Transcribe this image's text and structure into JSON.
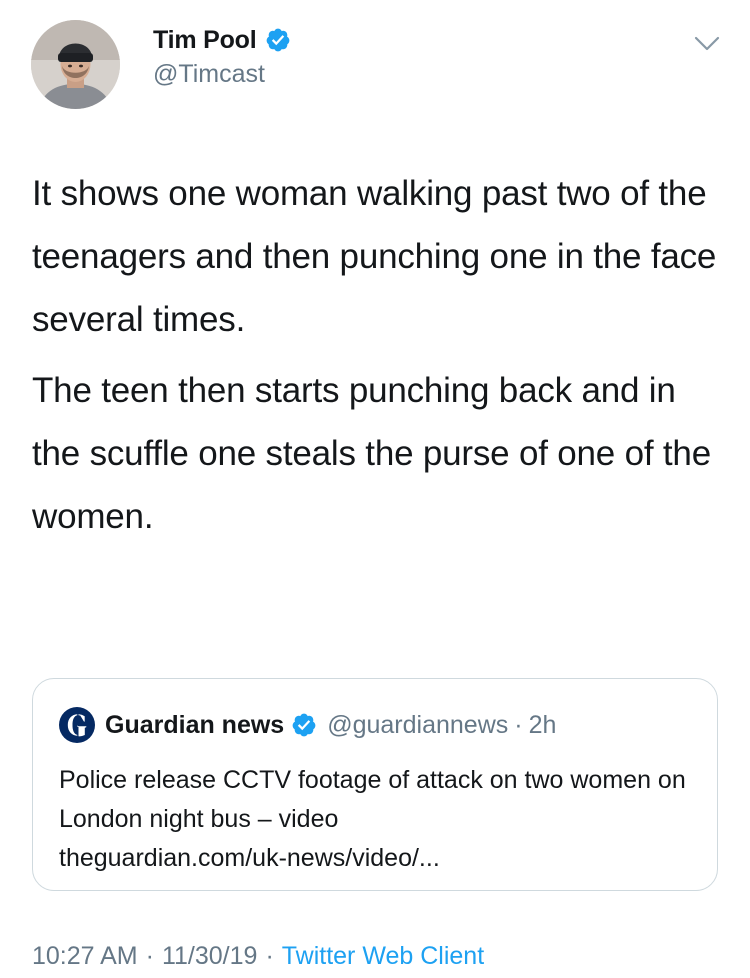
{
  "author": {
    "name": "Tim Pool",
    "handle": "@Timcast",
    "verified": true
  },
  "tweet": {
    "paragraphs": [
      "It shows one woman walking past two of the teenagers and then punching one in the face several times.",
      "The teen then starts punching back and in the scuffle one steals the purse of one of the women."
    ]
  },
  "quoted_tweet": {
    "name": "Guardian news",
    "handle": "@guardiannews",
    "separator": "·",
    "time": "2h",
    "text": "Police release CCTV footage of attack on two women on London night bus – video",
    "link": "theguardian.com/uk-news/video/..."
  },
  "meta": {
    "time": "10:27 AM",
    "date": "11/30/19",
    "separator": "·",
    "client": "Twitter Web Client"
  },
  "colors": {
    "text": "#14171a",
    "secondary": "#657786",
    "accent": "#1da1f2",
    "border": "#cfd9de"
  },
  "icons": {
    "verified": "verified-badge-icon",
    "more": "chevron-down-icon",
    "guardian_logo": "guardian-g-logo"
  }
}
